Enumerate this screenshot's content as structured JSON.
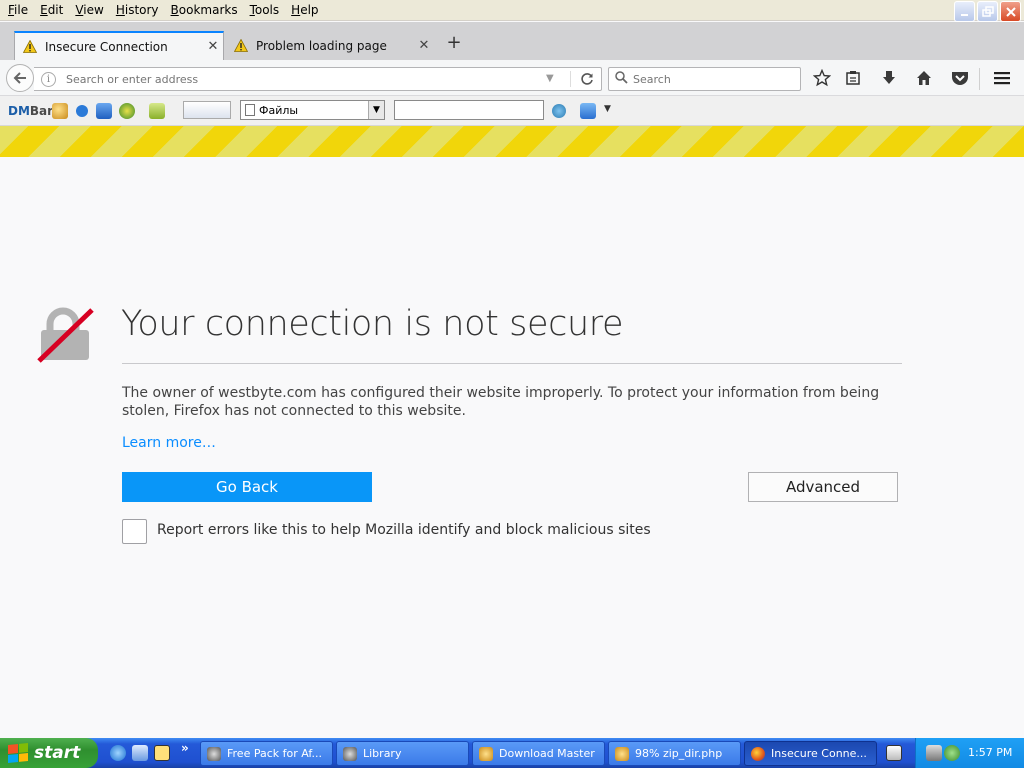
{
  "menubar": {
    "items": [
      {
        "label": "File",
        "key": "F",
        "rest": "ile"
      },
      {
        "label": "Edit",
        "key": "E",
        "rest": "dit"
      },
      {
        "label": "View",
        "key": "V",
        "rest": "iew"
      },
      {
        "label": "History",
        "key": "H",
        "rest": "istory"
      },
      {
        "label": "Bookmarks",
        "key": "B",
        "rest": "ookmarks"
      },
      {
        "label": "Tools",
        "key": "T",
        "rest": "ools"
      },
      {
        "label": "Help",
        "key": "H",
        "rest": "elp"
      }
    ]
  },
  "tabs": [
    {
      "label": "Insecure Connection",
      "icon": "warning-icon",
      "active": true
    },
    {
      "label": "Problem loading page",
      "icon": "warning-icon",
      "active": false
    }
  ],
  "navbar": {
    "url_placeholder": "Search or enter address",
    "search_placeholder": "Search"
  },
  "dmbar": {
    "logo_dm": "DM",
    "logo_bar": "Bar",
    "select_value": "Файлы"
  },
  "page": {
    "title": "Your connection is not secure",
    "description": "The owner of westbyte.com has configured their website improperly. To protect your information from being stolen, Firefox has not connected to this website.",
    "learn_more": "Learn more…",
    "go_back": "Go Back",
    "advanced": "Advanced",
    "report_label": "Report errors like this to help Mozilla identify and block malicious sites"
  },
  "taskbar": {
    "start": "start",
    "tasks": [
      {
        "label": "Free Pack for Af...",
        "active": false
      },
      {
        "label": "Library",
        "active": false
      },
      {
        "label": "Download Master",
        "active": false
      },
      {
        "label": "98% zip_dir.php",
        "active": false
      },
      {
        "label": "Insecure Conne...",
        "active": true
      }
    ],
    "clock": "1:57 PM"
  },
  "colors": {
    "accent": "#0996f8",
    "stripe_yellow": "#f1d60a",
    "link": "#0a8dff",
    "taskbar_blue": "#2459d8",
    "start_green": "#37a237"
  }
}
